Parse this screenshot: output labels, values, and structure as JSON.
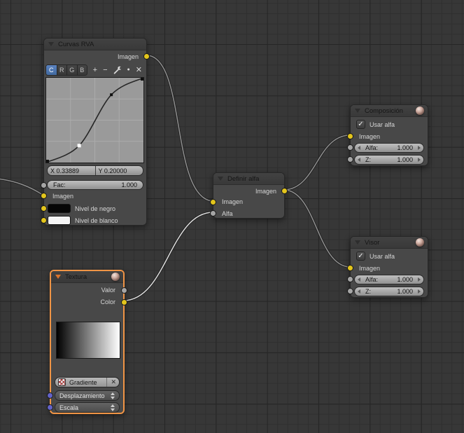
{
  "icons": {
    "plus": "+",
    "minus": "−",
    "dot": "●",
    "close": "✕",
    "check": "✓",
    "unlink": "✕"
  },
  "colors": {
    "socket_yellow": "#e3c51c",
    "socket_gray": "#a6a6a6",
    "socket_vector": "#6363c7",
    "selected_border": "#f09445",
    "node_body": "#484848",
    "node_header": "#3d3d3d",
    "wire": "#8f8f8f",
    "wire_selected": "#e0e0e0",
    "active_channel_blue": "#4a70ac"
  },
  "nodes": {
    "curvas_rva": {
      "title": "Curvas RVA",
      "output_imagen": "Imagen",
      "channels": [
        "C",
        "R",
        "G",
        "B"
      ],
      "active_channel": "C",
      "point_x": "X 0.33889",
      "point_y": "Y 0.20000",
      "fac_label": "Fac:",
      "fac_value": "1.000",
      "input_imagen": "Imagen",
      "black_level": "Nivel de negro",
      "white_level": "Nivel de blanco",
      "curve_points": [
        [
          0,
          0
        ],
        [
          0.339,
          0.2
        ],
        [
          0.67,
          0.8
        ],
        [
          1,
          1
        ]
      ],
      "selected_point": [
        0.33889,
        0.2
      ]
    },
    "definir_alfa": {
      "title": "Definir alfa",
      "output_imagen": "Imagen",
      "input_imagen": "Imagen",
      "input_alfa": "Alfa"
    },
    "composicion": {
      "title": "Composición",
      "use_alpha": "Usar alfa",
      "input_imagen": "Imagen",
      "alfa_label": "Alfa:",
      "alfa_value": "1.000",
      "z_label": "Z:",
      "z_value": "1.000"
    },
    "visor": {
      "title": "Visor",
      "use_alpha": "Usar alfa",
      "input_imagen": "Imagen",
      "alfa_label": "Alfa:",
      "alfa_value": "1.000",
      "z_label": "Z:",
      "z_value": "1.000"
    },
    "textura": {
      "title": "Textura",
      "output_valor": "Valor",
      "output_color": "Color",
      "texture_name": "Gradiente",
      "offset_label": "Desplazamiento",
      "scale_label": "Escala"
    }
  }
}
